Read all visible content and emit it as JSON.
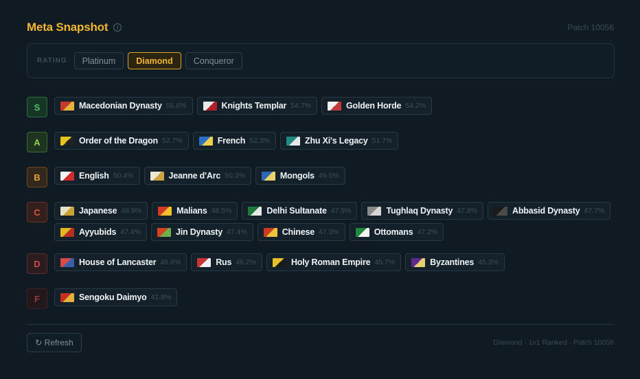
{
  "header": {
    "title": "Meta Snapshot",
    "info_icon": "i",
    "patch": "Patch 10056"
  },
  "rating": {
    "label": "RATING",
    "options": [
      "Platinum",
      "Diamond",
      "Conqueror"
    ],
    "selected": "Diamond"
  },
  "tiers": [
    {
      "letter": "S",
      "color": "#4cc56b",
      "bg": "#173524",
      "border": "#2c6a3f",
      "civs": [
        {
          "name": "Macedonian Dynasty",
          "winrate": "56.6%",
          "flag": [
            "#c43b2a",
            "#e8b13a"
          ]
        },
        {
          "name": "Knights Templar",
          "winrate": "54.7%",
          "flag": [
            "#e8e8e8",
            "#b21f2a"
          ]
        },
        {
          "name": "Golden Horde",
          "winrate": "54.2%",
          "flag": [
            "#f1f1f1",
            "#c03a3a"
          ]
        }
      ]
    },
    {
      "letter": "A",
      "color": "#8fd14f",
      "bg": "#1e3320",
      "border": "#3c6a31",
      "civs": [
        {
          "name": "Order of the Dragon",
          "winrate": "52.7%",
          "flag": [
            "#e7c51e",
            "#222222"
          ]
        },
        {
          "name": "French",
          "winrate": "52.3%",
          "flag": [
            "#2b6fc9",
            "#f0d24a"
          ]
        },
        {
          "name": "Zhu Xi's Legacy",
          "winrate": "51.7%",
          "flag": [
            "#1e8a82",
            "#e8e8e8"
          ]
        }
      ]
    },
    {
      "letter": "B",
      "color": "#e8a23a",
      "bg": "#33261a",
      "border": "#6b4a25",
      "civs": [
        {
          "name": "English",
          "winrate": "50.4%",
          "flag": [
            "#f3f3f3",
            "#cf2b2b"
          ]
        },
        {
          "name": "Jeanne d'Arc",
          "winrate": "50.3%",
          "flag": [
            "#ede7d6",
            "#c9a441"
          ]
        },
        {
          "name": "Mongols",
          "winrate": "49.5%",
          "flag": [
            "#2e66b8",
            "#e8d36a"
          ]
        }
      ]
    },
    {
      "letter": "C",
      "color": "#e0573e",
      "bg": "#33201d",
      "border": "#6a3229",
      "civs": [
        {
          "name": "Japanese",
          "winrate": "48.9%",
          "flag": [
            "#e5e0c8",
            "#caa337"
          ]
        },
        {
          "name": "Malians",
          "winrate": "48.5%",
          "flag": [
            "#d23a25",
            "#f0c12d"
          ]
        },
        {
          "name": "Delhi Sultanate",
          "winrate": "47.9%",
          "flag": [
            "#1e7a3a",
            "#e8e8e8"
          ]
        },
        {
          "name": "Tughlaq Dynasty",
          "winrate": "47.8%",
          "flag": [
            "#8a8a8a",
            "#d6d6d6"
          ]
        },
        {
          "name": "Abbasid Dynasty",
          "winrate": "47.7%",
          "flag": [
            "#1a1a1a",
            "#4a4a4a"
          ]
        },
        {
          "name": "Ayyubids",
          "winrate": "47.4%",
          "flag": [
            "#e3b823",
            "#b7301f"
          ]
        },
        {
          "name": "Jin Dynasty",
          "winrate": "47.4%",
          "flag": [
            "#d6411f",
            "#6eb04a"
          ]
        },
        {
          "name": "Chinese",
          "winrate": "47.3%",
          "flag": [
            "#cc3a22",
            "#f0c33d"
          ]
        },
        {
          "name": "Ottomans",
          "winrate": "47.2%",
          "flag": [
            "#1f8a3d",
            "#f3f3f3"
          ]
        }
      ]
    },
    {
      "letter": "D",
      "color": "#c94a4a",
      "bg": "#2c1c1f",
      "border": "#5a2d31",
      "civs": [
        {
          "name": "House of Lancaster",
          "winrate": "46.6%",
          "flag": [
            "#d84a4a",
            "#3a5fa8"
          ]
        },
        {
          "name": "Rus",
          "winrate": "46.2%",
          "flag": [
            "#c93434",
            "#f0f0f0"
          ]
        },
        {
          "name": "Holy Roman Empire",
          "winrate": "45.7%",
          "flag": [
            "#e8c028",
            "#1a1a1a"
          ]
        },
        {
          "name": "Byzantines",
          "winrate": "45.3%",
          "flag": [
            "#5b2a8f",
            "#e7d070"
          ]
        }
      ]
    },
    {
      "letter": "F",
      "color": "#9a3a3a",
      "bg": "#22181b",
      "border": "#3e2226",
      "civs": [
        {
          "name": "Sengoku Daimyo",
          "winrate": "41.8%",
          "flag": [
            "#c4301f",
            "#e6b13b"
          ]
        }
      ]
    }
  ],
  "footer": {
    "refresh_label": "↻ Refresh",
    "info": "Diamond · 1v1 Ranked · Patch 10056"
  }
}
